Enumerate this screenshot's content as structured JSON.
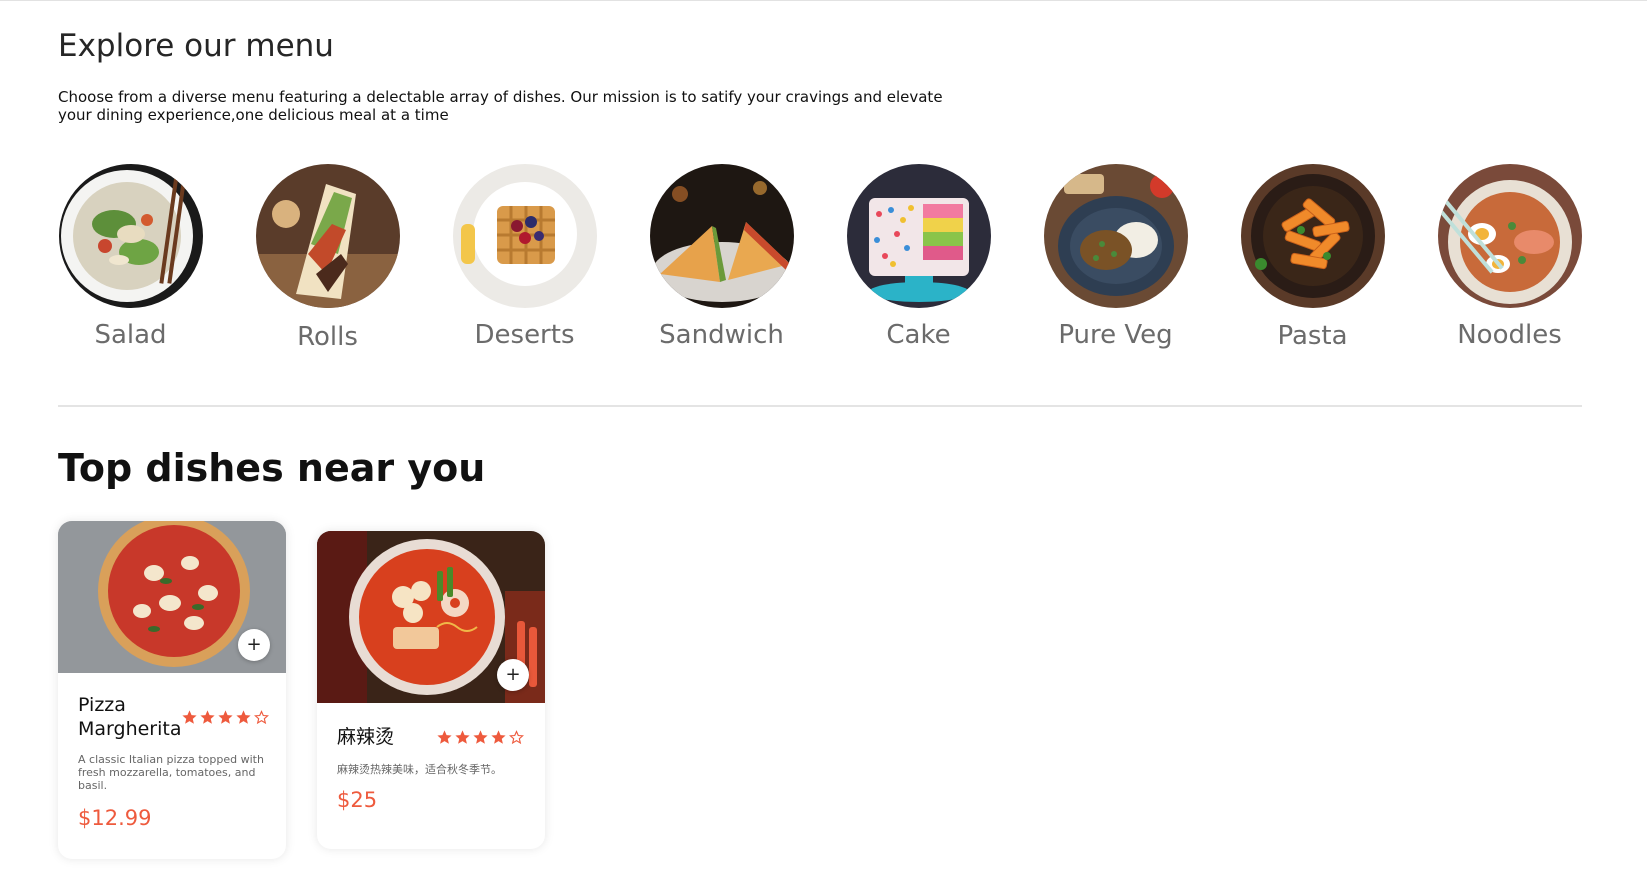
{
  "explore": {
    "title": "Explore our menu",
    "description": "Choose from a diverse menu featuring a delectable array of dishes. Our mission is to satify your cravings and elevate your dining experience,one delicious meal at a time"
  },
  "menu": [
    {
      "label": "Salad"
    },
    {
      "label": "Rolls"
    },
    {
      "label": "Deserts"
    },
    {
      "label": "Sandwich"
    },
    {
      "label": "Cake"
    },
    {
      "label": "Pure Veg"
    },
    {
      "label": "Pasta"
    },
    {
      "label": "Noodles"
    }
  ],
  "top": {
    "title": "Top dishes near you",
    "dishes": [
      {
        "name": "Pizza Margherita",
        "rating": 4,
        "description": "A classic Italian pizza topped with fresh mozzarella, tomatoes, and basil.",
        "price": "$12.99",
        "add_label": "+"
      },
      {
        "name": "麻辣烫",
        "rating": 4,
        "description": "麻辣烫热辣美味，适合秋冬季节。",
        "price": "$25",
        "add_label": "+"
      }
    ]
  },
  "colors": {
    "accent": "#ee5a3d",
    "heading": "#262626",
    "menu_label": "#6b6b6b"
  }
}
